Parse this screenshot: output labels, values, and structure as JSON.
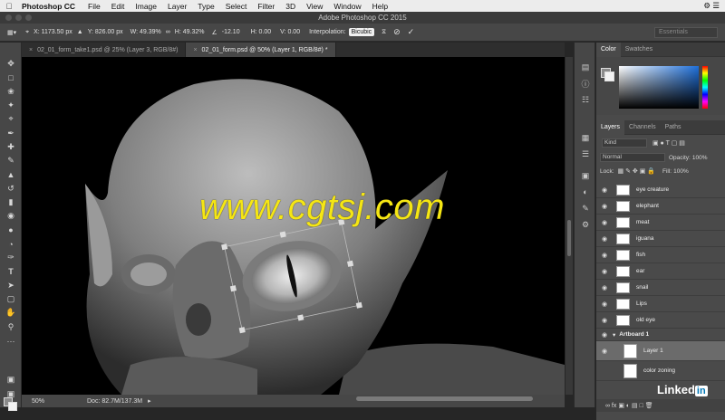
{
  "menubar": {
    "app_name": "Photoshop CC",
    "items": [
      "File",
      "Edit",
      "Image",
      "Layer",
      "Type",
      "Select",
      "Filter",
      "3D",
      "View",
      "Window",
      "Help"
    ]
  },
  "titlebar": {
    "title": "Adobe Photoshop CC 2015"
  },
  "options": {
    "x": "X: 1173.50 px",
    "y": "Y: 826.00 px",
    "w": "W: 49.39%",
    "h": "H: 49.32%",
    "angle": "-12.10",
    "hskew": "H: 0.00",
    "vskew": "V: 0.00",
    "interp_label": "Interpolation:",
    "interp_value": "Bicubic",
    "workspace": "Essentials"
  },
  "tabs": [
    {
      "label": "02_01_form_take1.psd @ 25% (Layer 3, RGB/8#)"
    },
    {
      "label": "02_01_form.psd @ 50% (Layer 1, RGB/8#) *"
    }
  ],
  "status": {
    "zoom": "50%",
    "doc": "Doc: 82.7M/137.3M"
  },
  "watermark": "www.cgtsj.com",
  "color_panel": {
    "tabs": [
      "Color",
      "Swatches"
    ]
  },
  "layers_panel": {
    "tabs": [
      "Layers",
      "Channels",
      "Paths"
    ],
    "kind": "Kind",
    "blend_mode": "Normal",
    "opacity_label": "Opacity:",
    "opacity": "100%",
    "lock_label": "Lock:",
    "fill_label": "Fill:",
    "fill": "100%",
    "layers": [
      "eye creature",
      "elephant",
      "meat",
      "iguana",
      "fish",
      "ear",
      "snail",
      "Lips",
      "old eye"
    ],
    "artboard": "Artboard 1",
    "artboard_layers": [
      "Layer 1",
      "color zoning"
    ]
  },
  "branding": {
    "linked": "Linked",
    "in": "in"
  },
  "colors": {
    "watermark": "#f5e614",
    "linkedin": "#0077b5"
  }
}
